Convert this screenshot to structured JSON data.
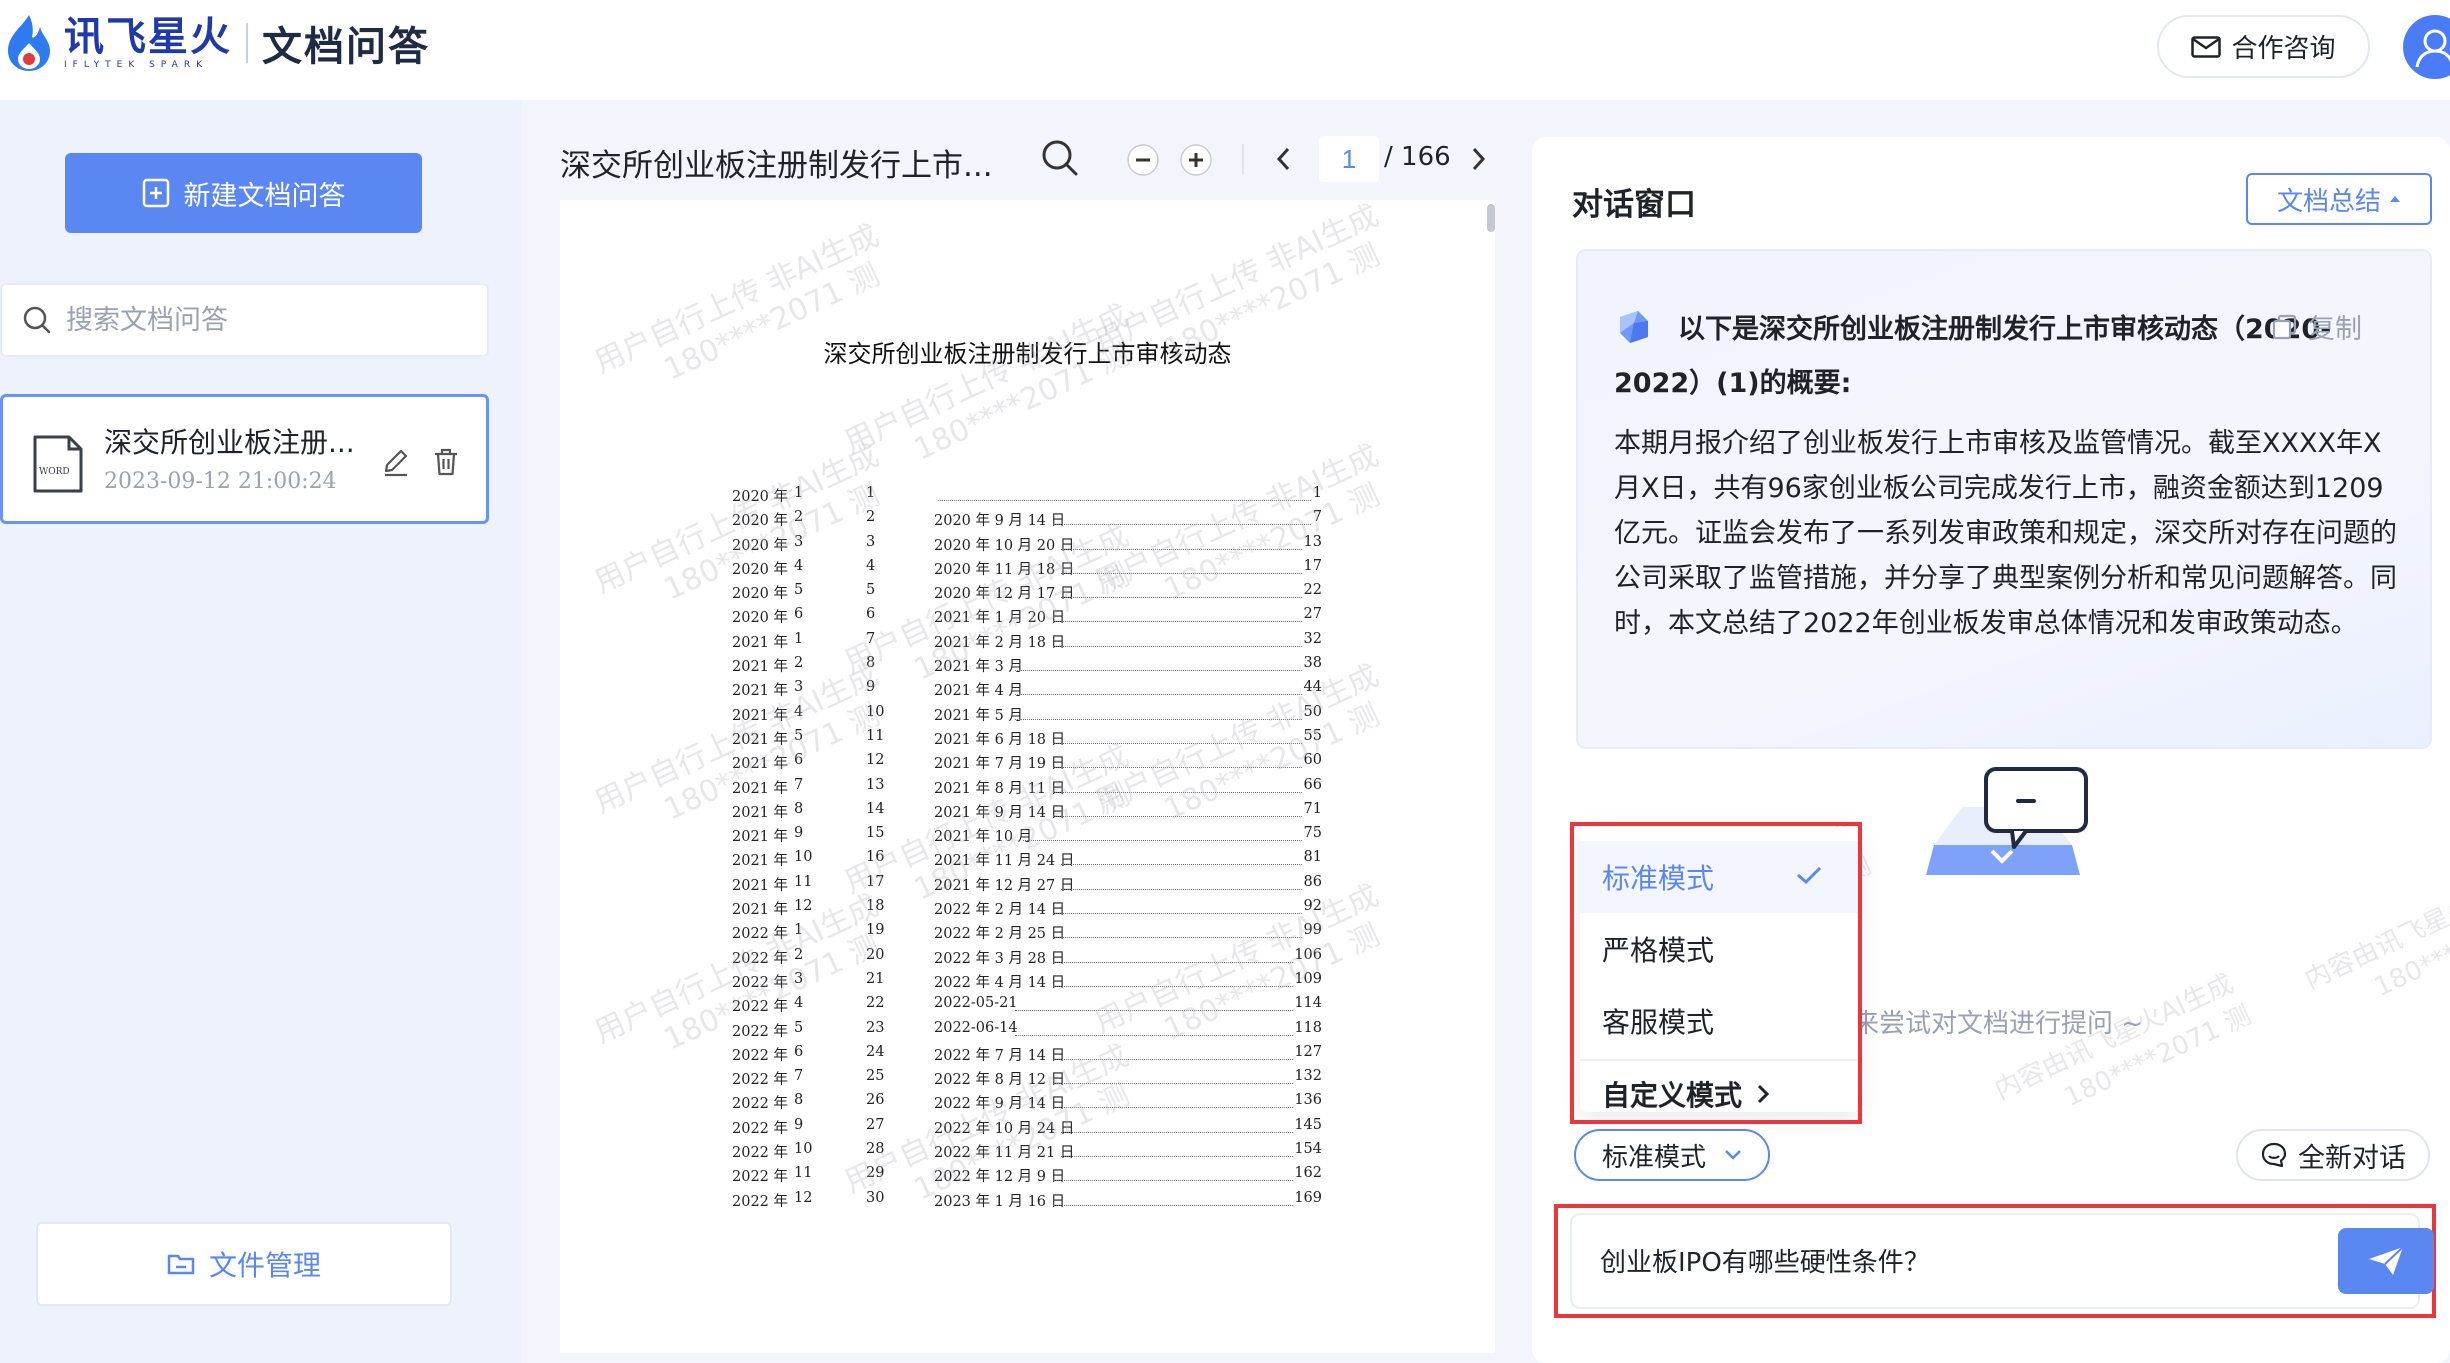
{
  "header": {
    "brand_cn": "讯飞星火",
    "brand_en": "IFLYTEK SPARK",
    "product": "文档问答",
    "consult_label": "合作咨询"
  },
  "sidebar": {
    "new_button_label": "新建文档问答",
    "search_placeholder": "搜索文档问答",
    "documents": [
      {
        "title": "深交所创业板注册...",
        "date": "2023-09-12 21:00:24",
        "file_type": "WORD"
      }
    ],
    "file_manager_label": "文件管理"
  },
  "viewer": {
    "title": "深交所创业板注册制发行上市...",
    "current_page": "1",
    "total_pages": "/ 166",
    "doc_heading": "深交所创业板注册制发行上市审核动态",
    "watermark_lines": [
      "用户自行上传 非AI生成",
      "180****2071 测"
    ],
    "toc": [
      {
        "year": "2020 年",
        "num": "1",
        "no": "1",
        "date": "",
        "page": "1"
      },
      {
        "year": "2020 年",
        "num": "2",
        "no": "2",
        "date": "2020 年 9 月 14 日",
        "page": "7"
      },
      {
        "year": "2020 年",
        "num": "3",
        "no": "3",
        "date": "2020 年 10 月 20 日",
        "page": "13"
      },
      {
        "year": "2020 年",
        "num": "4",
        "no": "4",
        "date": "2020 年 11 月 18 日",
        "page": "17"
      },
      {
        "year": "2020 年",
        "num": "5",
        "no": "5",
        "date": "2020 年 12 月 17 日",
        "page": "22"
      },
      {
        "year": "2020 年",
        "num": "6",
        "no": "6",
        "date": "2021 年 1 月 20 日",
        "page": "27"
      },
      {
        "year": "2021 年",
        "num": "1",
        "no": "7",
        "date": "2021 年 2 月 18 日",
        "page": "32"
      },
      {
        "year": "2021 年",
        "num": "2",
        "no": "8",
        "date": "2021 年 3 月",
        "page": "38"
      },
      {
        "year": "2021 年",
        "num": "3",
        "no": "9",
        "date": "2021 年 4 月",
        "page": "44"
      },
      {
        "year": "2021 年",
        "num": "4",
        "no": "10",
        "date": "2021 年 5 月",
        "page": "50"
      },
      {
        "year": "2021 年",
        "num": "5",
        "no": "11",
        "date": "2021 年 6 月 18 日",
        "page": "55"
      },
      {
        "year": "2021 年",
        "num": "6",
        "no": "12",
        "date": "2021 年 7 月 19 日",
        "page": "60"
      },
      {
        "year": "2021 年",
        "num": "7",
        "no": "13",
        "date": "2021 年 8 月 11 日",
        "page": "66"
      },
      {
        "year": "2021 年",
        "num": "8",
        "no": "14",
        "date": "2021 年 9 月 14 日",
        "page": "71"
      },
      {
        "year": "2021 年",
        "num": "9",
        "no": "15",
        "date": "2021 年 10 月",
        "page": "75"
      },
      {
        "year": "2021 年",
        "num": "10",
        "no": "16",
        "date": "2021 年 11 月 24 日",
        "page": "81"
      },
      {
        "year": "2021 年",
        "num": "11",
        "no": "17",
        "date": "2021 年 12 月 27 日",
        "page": "86"
      },
      {
        "year": "2021 年",
        "num": "12",
        "no": "18",
        "date": "2022 年 2 月 14 日",
        "page": "92"
      },
      {
        "year": "2022 年",
        "num": "1",
        "no": "19",
        "date": "2022 年 2 月 25 日",
        "page": "99"
      },
      {
        "year": "2022 年",
        "num": "2",
        "no": "20",
        "date": "2022 年 3 月 28 日",
        "page": "106"
      },
      {
        "year": "2022 年",
        "num": "3",
        "no": "21",
        "date": "2022 年 4 月 14 日",
        "page": "109"
      },
      {
        "year": "2022 年",
        "num": "4",
        "no": "22",
        "date": "2022-05-21",
        "page": "114"
      },
      {
        "year": "2022 年",
        "num": "5",
        "no": "23",
        "date": "2022-06-14",
        "page": "118"
      },
      {
        "year": "2022 年",
        "num": "6",
        "no": "24",
        "date": "2022 年 7 月 14 日",
        "page": "127"
      },
      {
        "year": "2022 年",
        "num": "7",
        "no": "25",
        "date": "2022 年 8 月 12 日",
        "page": "132"
      },
      {
        "year": "2022 年",
        "num": "8",
        "no": "26",
        "date": "2022 年 9 月 14 日",
        "page": "136"
      },
      {
        "year": "2022 年",
        "num": "9",
        "no": "27",
        "date": "2022 年 10 月 24 日",
        "page": "145"
      },
      {
        "year": "2022 年",
        "num": "10",
        "no": "28",
        "date": "2022 年 11 月 21 日",
        "page": "154"
      },
      {
        "year": "2022 年",
        "num": "11",
        "no": "29",
        "date": "2022 年 12 月 9 日",
        "page": "162"
      },
      {
        "year": "2022 年",
        "num": "12",
        "no": "30",
        "date": "2023 年 1 月 16 日",
        "page": "169"
      }
    ]
  },
  "chat": {
    "title": "对话窗口",
    "summary_button_label": "文档总结",
    "summary_heading": "以下是深交所创业板注册制发行上市审核动态（2020-2022）(1)的概要:",
    "copy_label": "复制",
    "summary_body": "本期月报介绍了创业板发行上市审核及监管情况。截至XXXX年X月X日，共有96家创业板公司完成发行上市，融资金额达到1209亿元。证监会发布了一系列发审政策和规定，深交所对存在问题的公司采取了监管措施，并分享了典型案例分析和常见问题解答。同时，本文总结了2022年创业板发审总体情况和发审政策动态。",
    "hint": "快来尝试对文档进行提问 ~",
    "watermark_lines": [
      "内容由讯飞星火AI生成",
      "180****2071 测"
    ],
    "mode_options": [
      "标准模式",
      "严格模式",
      "客服模式"
    ],
    "mode_custom": "自定义模式",
    "mode_selected": "标准模式",
    "new_chat_label": "全新对话",
    "input_value": "创业板IPO有哪些硬性条件？"
  },
  "colors": {
    "accent": "#5b87f2",
    "highlight_box": "#e8383d",
    "brand": "#1f3aa8"
  }
}
